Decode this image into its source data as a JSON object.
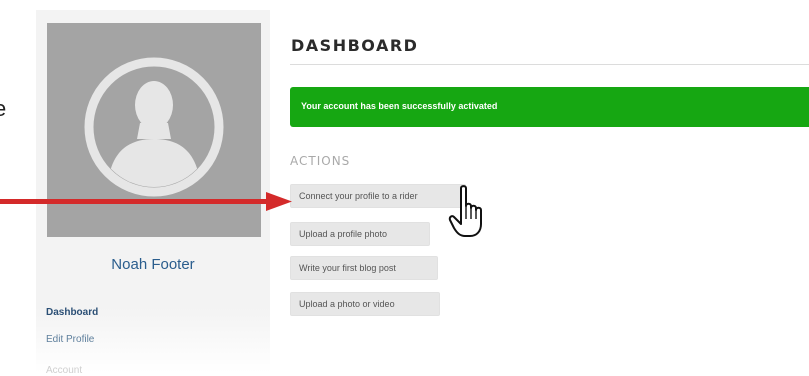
{
  "cut_text": "e",
  "sidebar": {
    "user_name": "Noah Footer",
    "nav": [
      {
        "label": "Dashboard"
      },
      {
        "label": "Edit Profile"
      },
      {
        "label": "Account"
      }
    ]
  },
  "main": {
    "title": "DASHBOARD",
    "alert": "Your account has been successfully activated",
    "actions_label": "ACTIONS",
    "actions": [
      {
        "label": "Connect your profile to a rider"
      },
      {
        "label": "Upload a profile photo"
      },
      {
        "label": "Write your first blog post"
      },
      {
        "label": "Upload a photo or video"
      }
    ]
  },
  "colors": {
    "alert_green": "#16a712",
    "arrow_red": "#d42a2a",
    "link_blue": "#2a5d8d"
  },
  "icons": {
    "avatar": "user-silhouette-icon",
    "cursor": "hand-pointer-icon",
    "annotation": "red-arrow"
  }
}
